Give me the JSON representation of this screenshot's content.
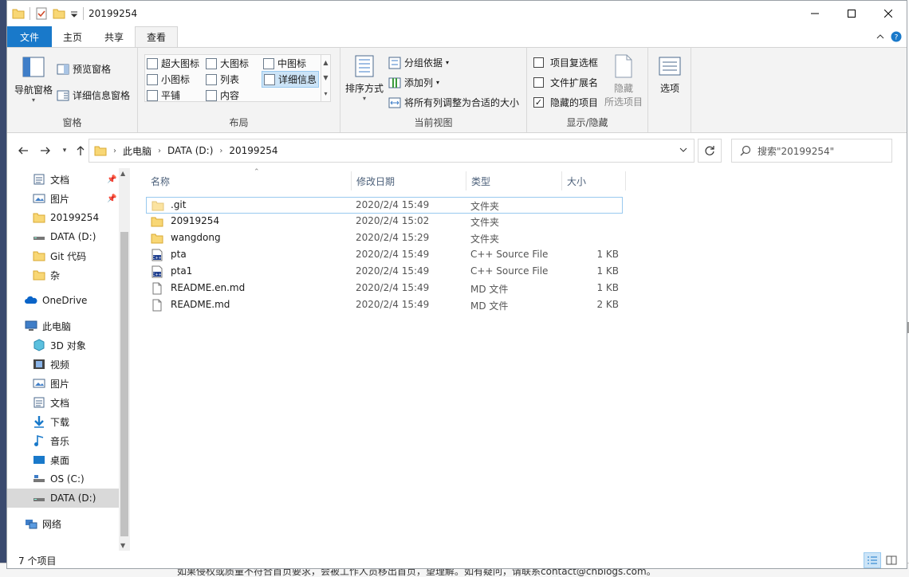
{
  "background": {
    "bottom_text": "如果侵权或质量不符合首页要求，会被工作人员移出首页，望理解。如有疑问，请联系contact@cnblogs.com。"
  },
  "title": "20199254",
  "window_controls": {
    "minimize": "minimize-icon",
    "maximize": "maximize-icon",
    "close": "close-icon"
  },
  "tabs": [
    {
      "label": "文件"
    },
    {
      "label": "主页"
    },
    {
      "label": "共享"
    },
    {
      "label": "查看"
    }
  ],
  "ribbon": {
    "pane_group": {
      "label": "窗格",
      "nav_pane": "导航窗格",
      "preview_pane": "预览窗格",
      "details_pane": "详细信息窗格"
    },
    "layout_group": {
      "label": "布局",
      "items": [
        "超大图标",
        "大图标",
        "中图标",
        "小图标",
        "列表",
        "详细信息",
        "平铺",
        "内容"
      ]
    },
    "current_view_group": {
      "label": "当前视图",
      "sort_by": "排序方式",
      "group_by": "分组依据",
      "add_column": "添加列",
      "fit_columns": "将所有列调整为合适的大小"
    },
    "show_hide_group": {
      "label": "显示/隐藏",
      "item_checkboxes": {
        "label": "项目复选框",
        "checked": false
      },
      "file_extensions": {
        "label": "文件扩展名",
        "checked": false
      },
      "hidden_items": {
        "label": "隐藏的项目",
        "checked": true
      },
      "hide_selected": "隐藏\n所选项目",
      "hide_selected_line1": "隐藏",
      "hide_selected_line2": "所选项目"
    },
    "options": "选项"
  },
  "address": {
    "crumbs": [
      "此电脑",
      "DATA (D:)",
      "20199254"
    ],
    "search_placeholder": "搜索\"20199254\""
  },
  "nav": [
    {
      "label": "文档",
      "icon": "documents-icon",
      "pinned": true
    },
    {
      "label": "图片",
      "icon": "pictures-icon",
      "pinned": true
    },
    {
      "label": "20199254",
      "icon": "folder-icon",
      "pinned": false
    },
    {
      "label": "DATA (D:)",
      "icon": "drive-icon",
      "pinned": false
    },
    {
      "label": "Git 代码",
      "icon": "folder-icon",
      "pinned": false
    },
    {
      "label": "杂",
      "icon": "folder-icon",
      "pinned": false
    },
    {
      "label": "OneDrive",
      "icon": "onedrive-icon",
      "pinned": false
    },
    {
      "label": "此电脑",
      "icon": "computer-icon",
      "pinned": false
    },
    {
      "label": "3D 对象",
      "icon": "3d-objects-icon",
      "pinned": false
    },
    {
      "label": "视频",
      "icon": "videos-icon",
      "pinned": false
    },
    {
      "label": "图片",
      "icon": "pictures-icon",
      "pinned": false
    },
    {
      "label": "文档",
      "icon": "documents-icon",
      "pinned": false
    },
    {
      "label": "下载",
      "icon": "downloads-icon",
      "pinned": false
    },
    {
      "label": "音乐",
      "icon": "music-icon",
      "pinned": false
    },
    {
      "label": "桌面",
      "icon": "desktop-icon",
      "pinned": false
    },
    {
      "label": "OS (C:)",
      "icon": "drive-c-icon",
      "pinned": false
    },
    {
      "label": "DATA (D:)",
      "icon": "drive-icon",
      "pinned": false
    },
    {
      "label": "网络",
      "icon": "network-icon",
      "pinned": false
    }
  ],
  "columns": [
    "名称",
    "修改日期",
    "类型",
    "大小"
  ],
  "files": [
    {
      "name": ".git",
      "date": "2020/2/4 15:49",
      "type": "文件夹",
      "size": "",
      "icon": "folder-icon"
    },
    {
      "name": "20919254",
      "date": "2020/2/4 15:02",
      "type": "文件夹",
      "size": "",
      "icon": "folder-icon"
    },
    {
      "name": "wangdong",
      "date": "2020/2/4 15:29",
      "type": "文件夹",
      "size": "",
      "icon": "folder-icon"
    },
    {
      "name": "pta",
      "date": "2020/2/4 15:49",
      "type": "C++ Source File",
      "size": "1 KB",
      "icon": "cpp-file-icon"
    },
    {
      "name": "pta1",
      "date": "2020/2/4 15:49",
      "type": "C++ Source File",
      "size": "1 KB",
      "icon": "cpp-file-icon"
    },
    {
      "name": "README.en.md",
      "date": "2020/2/4 15:49",
      "type": "MD 文件",
      "size": "1 KB",
      "icon": "file-icon"
    },
    {
      "name": "README.md",
      "date": "2020/2/4 15:49",
      "type": "MD 文件",
      "size": "2 KB",
      "icon": "file-icon"
    }
  ],
  "status": {
    "count": "7 个项目"
  },
  "colors": {
    "accent": "#1979ca",
    "folder": "#f8d775",
    "selection": "#cce4f7"
  }
}
